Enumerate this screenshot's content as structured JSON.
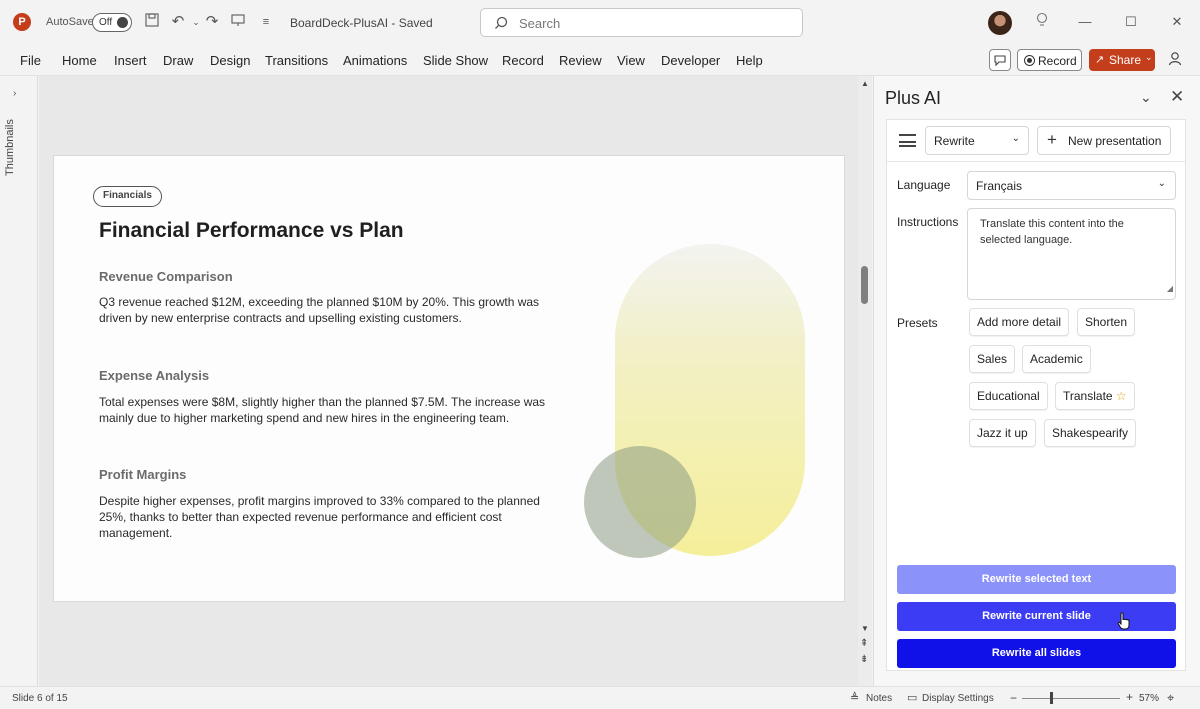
{
  "app": {
    "autosave_label": "AutoSave",
    "autosave_state": "Off",
    "document_title": "BoardDeck-PlusAI - Saved",
    "search_placeholder": "Search"
  },
  "ribbon": {
    "tabs": [
      "File",
      "Home",
      "Insert",
      "Draw",
      "Design",
      "Transitions",
      "Animations",
      "Slide Show",
      "Record",
      "Review",
      "View",
      "Developer",
      "Help"
    ],
    "record_label": "Record",
    "share_label": "Share"
  },
  "thumbnails": {
    "label": "Thumbnails"
  },
  "slide": {
    "tag": "Financials",
    "title": "Financial Performance vs Plan",
    "sections": [
      {
        "heading": "Revenue Comparison",
        "body": "Q3 revenue reached $12M, exceeding the planned $10M by 20%. This growth was driven by new enterprise contracts and upselling existing customers."
      },
      {
        "heading": "Expense Analysis",
        "body": "Total expenses were $8M, slightly higher than the planned $7.5M. The increase was mainly due to higher marketing spend and new hires in the engineering team."
      },
      {
        "heading": "Profit Margins",
        "body": "Despite higher expenses, profit margins improved to 33% compared to the planned 25%, thanks to better than expected revenue performance and efficient cost management."
      }
    ]
  },
  "pane": {
    "title": "Plus AI",
    "mode": "Rewrite",
    "new_presentation": "New presentation",
    "language_label": "Language",
    "language_value": "Français",
    "instructions_label": "Instructions",
    "instructions_value": "Translate this content into the selected language.",
    "presets_label": "Presets",
    "presets": [
      "Add more detail",
      "Shorten",
      "Sales",
      "Academic",
      "Educational",
      "Translate",
      "Jazz it up",
      "Shakespearify"
    ],
    "actions": {
      "rewrite_selected": "Rewrite selected text",
      "rewrite_current": "Rewrite current slide",
      "rewrite_all": "Rewrite all slides"
    },
    "colors": {
      "rewrite_selected": "#8b93fb",
      "rewrite_current": "#3c3cf5",
      "rewrite_all": "#1010e8"
    }
  },
  "status": {
    "slide_position": "Slide 6 of 15",
    "notes": "Notes",
    "display_settings": "Display Settings",
    "zoom": "57%"
  },
  "colors": {
    "brand": "#c43e1c"
  }
}
